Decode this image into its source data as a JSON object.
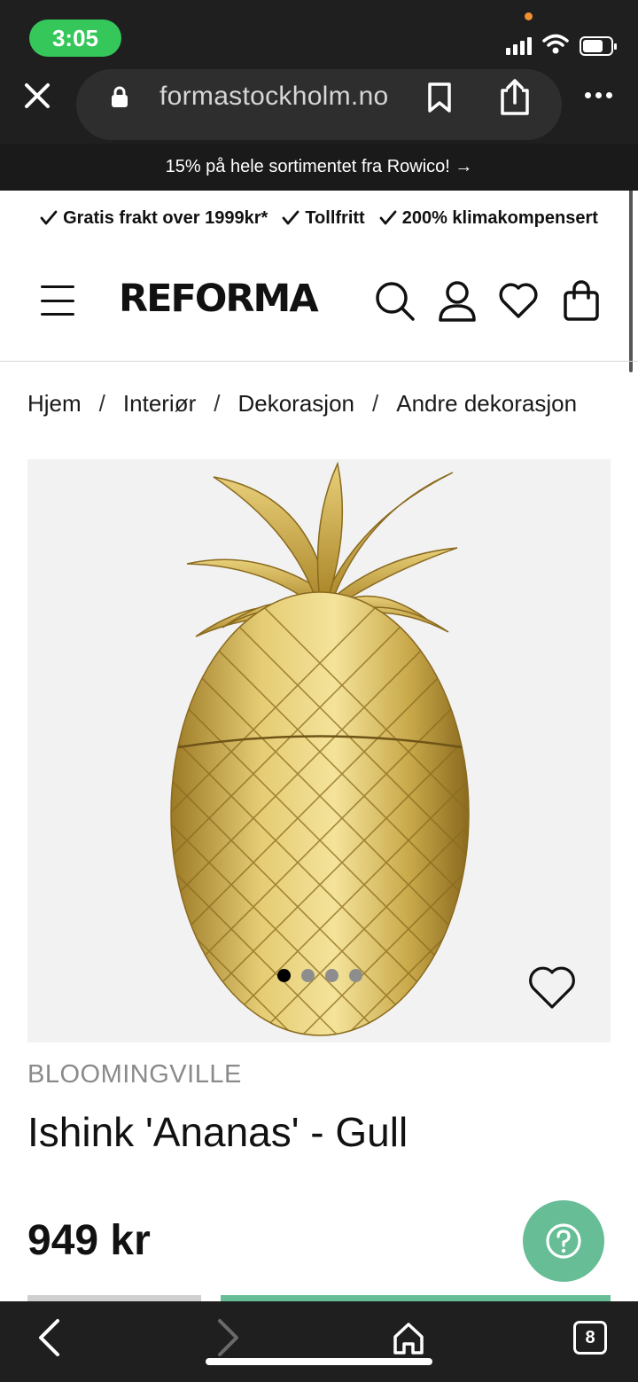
{
  "status_bar": {
    "time": "3:05"
  },
  "browser": {
    "url": "formastockholm.no"
  },
  "promo": {
    "text": "15% på hele sortimentet fra Rowico! →"
  },
  "usps": [
    {
      "label": "Gratis frakt over 1999kr*"
    },
    {
      "label": "Tollfritt"
    },
    {
      "label": "200% klimakompensert"
    }
  ],
  "header": {
    "logo": "REFORMA"
  },
  "breadcrumb": [
    "Hjem",
    "Interiør",
    "Dekorasjon",
    "Andre dekorasjon"
  ],
  "breadcrumb_separator": "/",
  "product": {
    "brand": "BLOOMINGVILLE",
    "title": "Ishink 'Ananas' - Gull",
    "price": "949 kr",
    "image_count": 4,
    "active_image": 1
  },
  "toolbar": {
    "tab_count": "8"
  },
  "colors": {
    "accent": "#66bd96",
    "chrome": "#1f1f1f",
    "status_pill": "#35c759",
    "gold": "#c9a94a"
  }
}
